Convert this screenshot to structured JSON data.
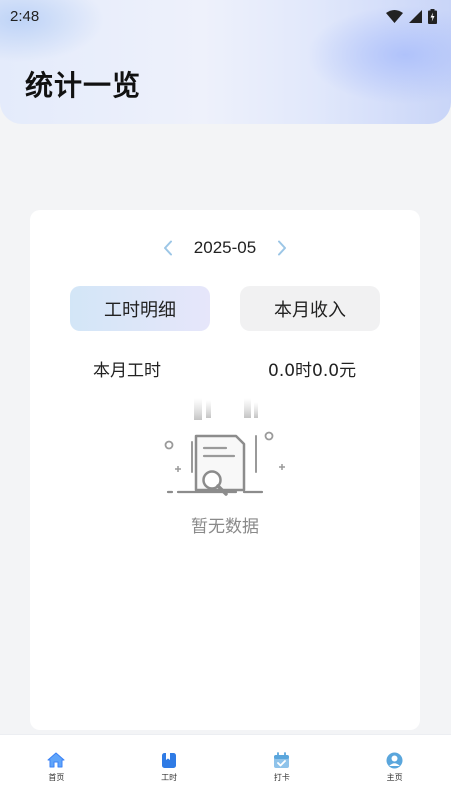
{
  "status_bar": {
    "time": "2:48"
  },
  "header": {
    "title": "统计一览"
  },
  "month_nav": {
    "current": "2025-05"
  },
  "tabs": [
    {
      "label": "工时明细",
      "active": true
    },
    {
      "label": "本月收入",
      "active": false
    }
  ],
  "stats": {
    "label": "本月工时",
    "value": "0.0时0.0元"
  },
  "empty_state": {
    "text": "暂无数据"
  },
  "bottom_nav": [
    {
      "label": "首页",
      "icon": "home-icon"
    },
    {
      "label": "工时",
      "icon": "bookmark-icon",
      "active": true
    },
    {
      "label": "打卡",
      "icon": "calendar-check-icon"
    },
    {
      "label": "主页",
      "icon": "user-icon"
    }
  ],
  "colors": {
    "accent": "#3b82f6",
    "arrow": "#9cc6e6"
  }
}
